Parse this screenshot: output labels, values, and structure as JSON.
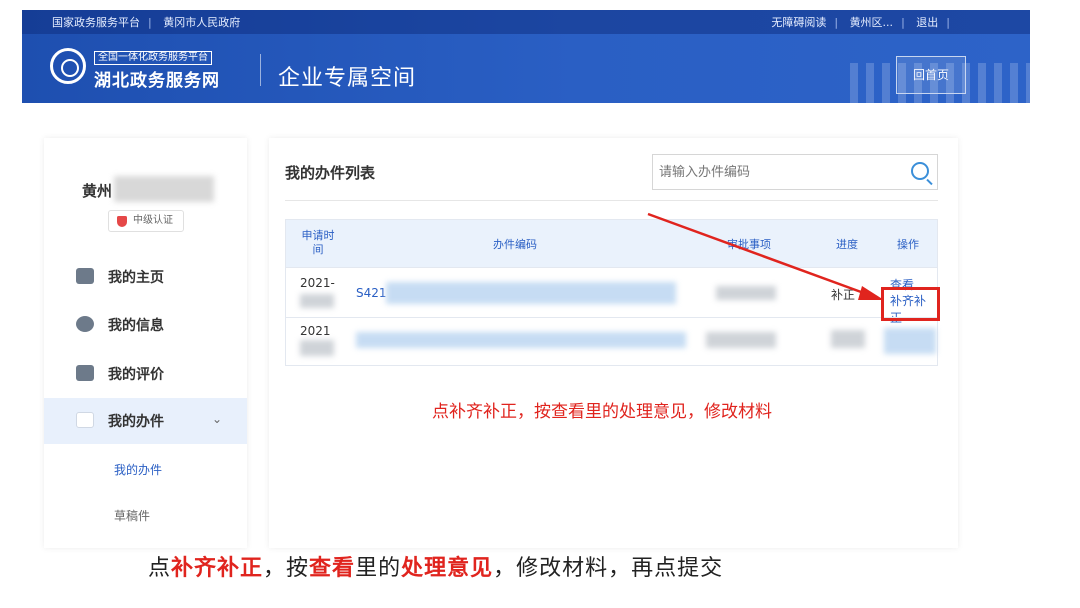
{
  "header": {
    "top_left": [
      "国家政务服务平台",
      "黄冈市人民政府"
    ],
    "top_right": [
      "无障碍阅读",
      "黄州区...",
      "退出"
    ],
    "brand_small": "全国一体化政务服务平台",
    "brand_main": "湖北政务服务网",
    "space_title": "企业专属空间",
    "home_button": "回首页"
  },
  "sidebar": {
    "user_name": "黄州",
    "auth_badge": "中级认证",
    "items": [
      {
        "label": "我的主页",
        "icon": "home-icon"
      },
      {
        "label": "我的信息",
        "icon": "message-icon"
      },
      {
        "label": "我的评价",
        "icon": "edit-icon"
      },
      {
        "label": "我的办件",
        "icon": "document-icon"
      }
    ],
    "chevron": "⌄",
    "sub_items": [
      "我的办件",
      "草稿件"
    ]
  },
  "main": {
    "title": "我的办件列表",
    "search_placeholder": "请输入办件编码",
    "columns": [
      "申请时间",
      "办件编码",
      "审批事项",
      "进度",
      "操作"
    ],
    "rows": [
      {
        "date": "2021-",
        "code": "S421",
        "progress": "补正",
        "actions": [
          "查看",
          "补齐补正"
        ]
      },
      {
        "date": "2021",
        "code": "",
        "progress": "",
        "actions": []
      }
    ]
  },
  "annotations": {
    "red_note": "点补齐补正，按查看里的处理意见，修改材料",
    "caption_parts": [
      "点",
      "补齐补正",
      "，按",
      "查看",
      "里的",
      "处理意见",
      "，修改材料，再点提交"
    ]
  },
  "colors": {
    "brand_blue": "#2a5fc4",
    "annotation_red": "#e0241e"
  }
}
